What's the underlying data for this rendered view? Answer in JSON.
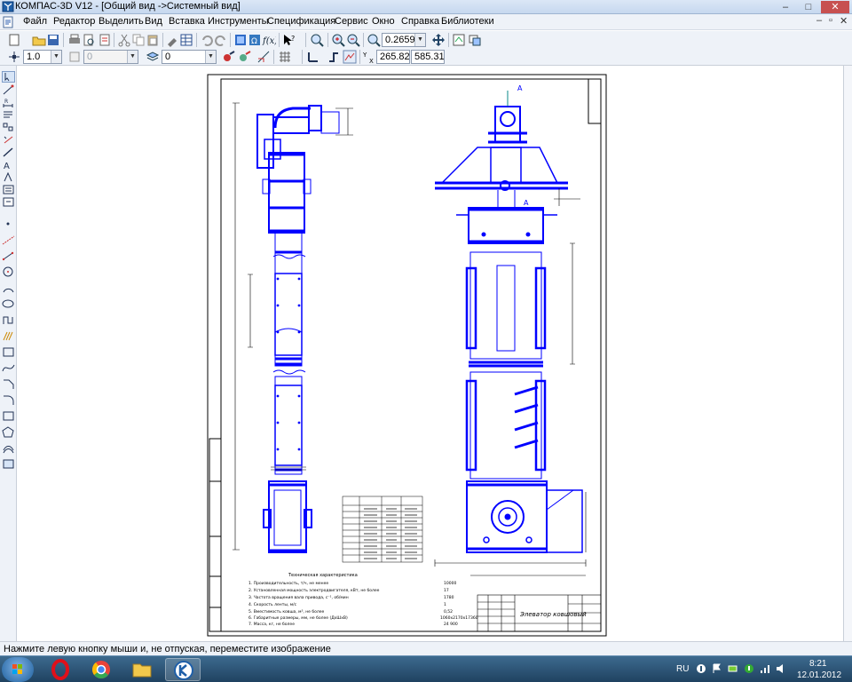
{
  "window": {
    "title": "КОМПАС-3D V12 - [Общий вид ->Системный вид]",
    "minimize": "–",
    "maximize": "□",
    "close": "✕"
  },
  "menu": {
    "items": [
      "Файл",
      "Редактор",
      "Выделить",
      "Вид",
      "Вставка",
      "Инструменты",
      "Спецификация",
      "Сервис",
      "Окно",
      "Справка",
      "Библиотеки"
    ],
    "doc_controls": [
      "–",
      "▫",
      "✕"
    ]
  },
  "toolbar": {
    "zoom_value": "0.2659",
    "line_scale": "1.0",
    "layer_field": "0",
    "state_field": "0",
    "coord_x": "265.821",
    "coord_y": "585.319"
  },
  "drawing": {
    "section_mark": "А",
    "title_block_text": "Элеватор ковшовый",
    "spec_title": "Техническая характеристика",
    "spec_lines": [
      "1. Производительность, т/ч, не менее",
      "2. Установленная мощность электродвигателя, кВт, не более",
      "3. Частота вращения вала привода, с⁻¹, об/мин",
      "4. Скорость ленты, м/с",
      "5. Вместимость ковша, м³, не более",
      "6. Габаритные размеры, мм, не более (ДхШхВ)",
      "7. Масса, кг, не более"
    ],
    "spec_values": [
      "10000",
      "17",
      "1780",
      "1",
      "0,52",
      "1060x2170x17360",
      "24 900"
    ]
  },
  "status": {
    "message": "Нажмите левую кнопку мыши и, не отпуская, переместите изображение"
  },
  "taskbar": {
    "lang": "RU",
    "time": "8:21",
    "date": "12.01.2012"
  },
  "colors": {
    "drawing_line": "#0000ff",
    "taskbar": "#2a5275",
    "menu_bg": "#eef2f8"
  }
}
